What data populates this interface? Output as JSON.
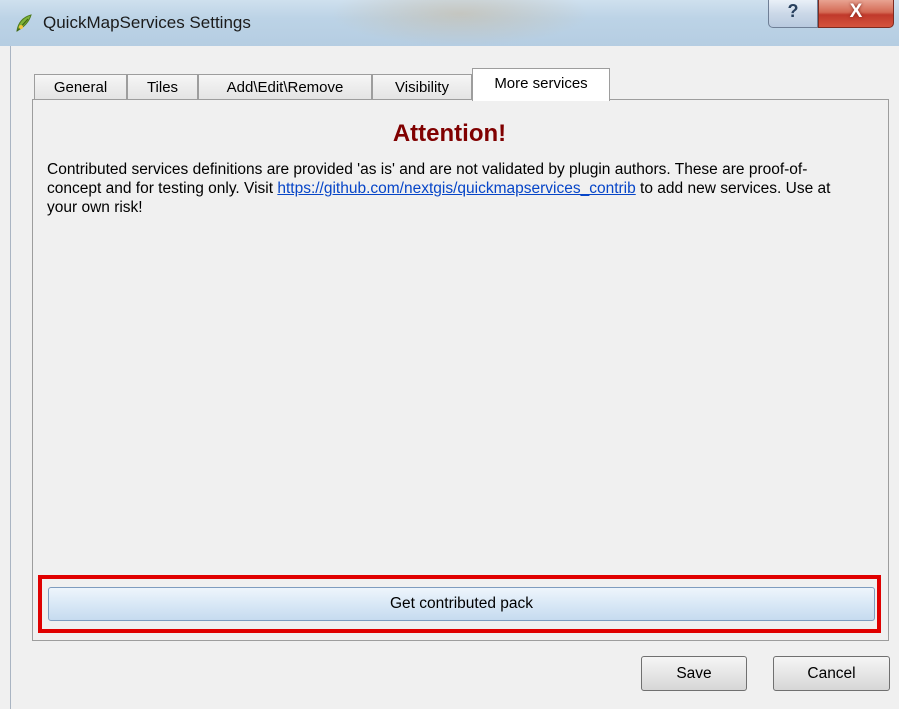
{
  "window": {
    "title": "QuickMapServices Settings",
    "help_symbol": "?",
    "close_symbol": "X"
  },
  "tabs": [
    {
      "label": "General"
    },
    {
      "label": "Tiles"
    },
    {
      "label": "Add\\Edit\\Remove"
    },
    {
      "label": "Visibility"
    },
    {
      "label": "More services"
    }
  ],
  "active_tab": "More services",
  "panel": {
    "heading": "Attention!",
    "text_before_link": "Contributed services definitions are provided 'as is' and are not validated by plugin authors. These are proof-of-concept and for testing only. Visit ",
    "link_text": "https://github.com/nextgis/quickmapservices_contrib",
    "text_after_link": " to add new services. Use at your own risk!",
    "get_pack_label": "Get contributed pack"
  },
  "footer": {
    "save_label": "Save",
    "cancel_label": "Cancel"
  },
  "colors": {
    "heading": "#800000",
    "link": "#0645c8",
    "highlight": "#e00000"
  },
  "icons": {
    "app": "qgis-leaf-icon"
  }
}
